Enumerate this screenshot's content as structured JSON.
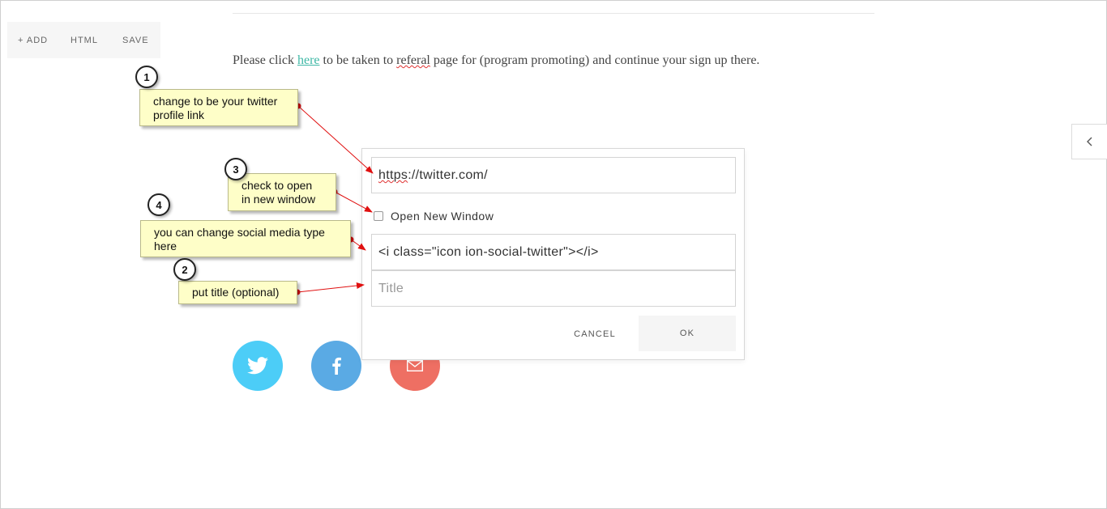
{
  "toolbar": {
    "add_label": "+ ADD",
    "html_label": "HTML",
    "save_label": "SAVE"
  },
  "content": {
    "text_before": "Please click ",
    "link_text": "here",
    "text_middle": " to be taken to ",
    "misspelled": "referal",
    "text_after": " page for (program promoting) and continue your sign up there."
  },
  "dialog": {
    "url_scheme": "https",
    "url_rest": "://twitter.com/",
    "open_new_window_label": "Open New Window",
    "open_new_window_checked": false,
    "icon_html": "<i class=\"icon ion-social-twitter\"></i>",
    "title_placeholder": "Title",
    "cancel_label": "CANCEL",
    "ok_label": "OK"
  },
  "social_icons": [
    {
      "icon": "twitter-icon",
      "color": "#4ccdf7"
    },
    {
      "icon": "facebook-icon",
      "color": "#5aaae4"
    },
    {
      "icon": "mail-icon",
      "color": "#ee6f63"
    }
  ],
  "annotations": [
    {
      "number": "1",
      "text": "change to be your twitter profile link"
    },
    {
      "number": "2",
      "text": "put title (optional)"
    },
    {
      "number": "3",
      "text": "check to open in new window"
    },
    {
      "number": "4",
      "text": "you can change social media type here"
    }
  ],
  "colors": {
    "link": "#3fb8a6",
    "note_bg": "#fefec8",
    "arrow": "#e01010"
  }
}
